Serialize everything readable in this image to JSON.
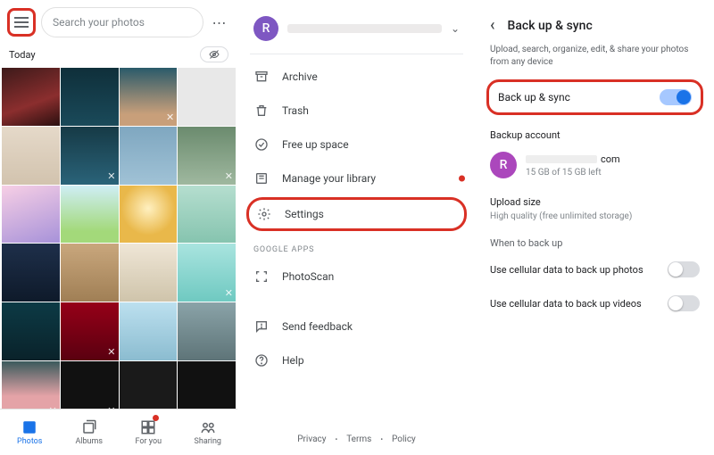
{
  "panel1": {
    "search_placeholder": "Search your photos",
    "date_label": "Today",
    "nav": {
      "photos": "Photos",
      "albums": "Albums",
      "foryou": "For you",
      "sharing": "Sharing"
    }
  },
  "panel2": {
    "avatar_letter": "R",
    "items": {
      "archive": "Archive",
      "trash": "Trash",
      "freeup": "Free up space",
      "manage": "Manage your library",
      "settings": "Settings"
    },
    "section_google_apps": "GOOGLE APPS",
    "photoscan": "PhotoScan",
    "feedback": "Send feedback",
    "help": "Help",
    "footer": {
      "privacy": "Privacy",
      "terms": "Terms",
      "policy": "Policy"
    }
  },
  "panel3": {
    "title": "Back up & sync",
    "subtitle": "Upload, search, organize, edit, & share your photos from any device",
    "sync_label": "Back up & sync",
    "backup_account_label": "Backup account",
    "avatar_letter": "R",
    "email_suffix": "com",
    "storage": "15 GB of 15 GB left",
    "upload_size_label": "Upload size",
    "upload_size_value": "High quality (free unlimited storage)",
    "when_label": "When to back up",
    "cell_photos": "Use cellular data to back up photos",
    "cell_videos": "Use cellular data to back up videos"
  }
}
